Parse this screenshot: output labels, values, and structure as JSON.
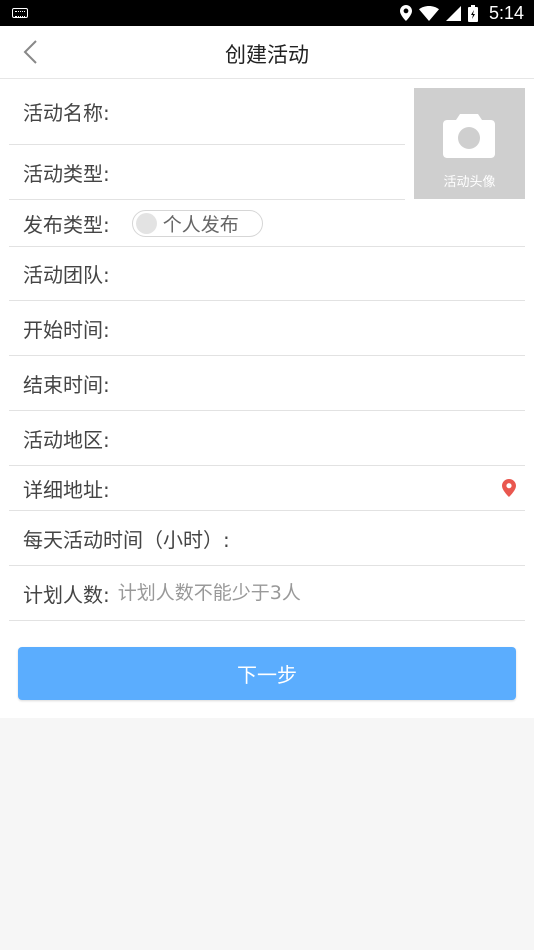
{
  "status_bar": {
    "time": "5:14"
  },
  "header": {
    "title": "创建活动"
  },
  "avatar": {
    "caption": "活动头像"
  },
  "form": {
    "activity_name": {
      "label": "活动名称:",
      "value": ""
    },
    "activity_type": {
      "label": "活动类型:",
      "value": ""
    },
    "publish_type": {
      "label": "发布类型:",
      "toggle_text": "个人发布"
    },
    "activity_team": {
      "label": "活动团队:",
      "value": ""
    },
    "start_time": {
      "label": "开始时间:",
      "value": ""
    },
    "end_time": {
      "label": "结束时间:",
      "value": ""
    },
    "activity_region": {
      "label": "活动地区:",
      "value": ""
    },
    "detail_address": {
      "label": "详细地址:",
      "value": ""
    },
    "daily_hours": {
      "label": "每天活动时间（小时）:",
      "value": ""
    },
    "planned_count": {
      "label": "计划人数:",
      "value": "",
      "placeholder": "计划人数不能少于3人"
    }
  },
  "actions": {
    "next_label": "下一步"
  },
  "colors": {
    "primary_button": "#5badfe",
    "location_pin": "#e9574f",
    "avatar_bg": "#cfcfcf"
  }
}
